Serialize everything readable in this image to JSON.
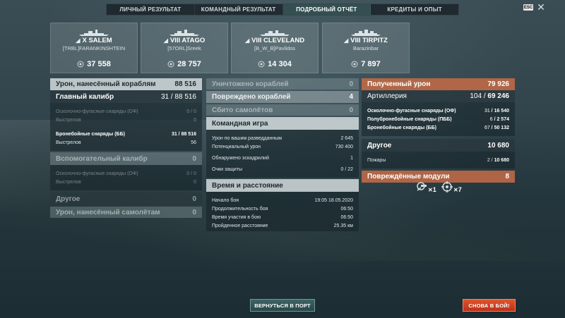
{
  "tabs": [
    {
      "label": "ЛИЧНЫЙ РЕЗУЛЬТАТ",
      "active": false
    },
    {
      "label": "КОМАНДНЫЙ РЕЗУЛЬТАТ",
      "active": false
    },
    {
      "label": "ПОДРОБНЫЙ ОТЧЁТ",
      "active": true
    },
    {
      "label": "КРЕДИТЫ И ОПЫТ",
      "active": false
    }
  ],
  "esc_label": "ESC",
  "close_glyph": "✕",
  "players": [
    {
      "tier": "X",
      "ship": "SALEM",
      "player": "[TRBL]FARANKINSHTEIN",
      "score": "37 558"
    },
    {
      "tier": "VIII",
      "ship": "ATAGO",
      "player": "[57ORL]Sreek",
      "score": "28 757"
    },
    {
      "tier": "VIII",
      "ship": "CLEVELAND",
      "player": "[B_W_B]Pavlidos",
      "score": "14 304"
    },
    {
      "tier": "VIII",
      "ship": "TIRPITZ",
      "player": "Barazinbar",
      "score": "7 897"
    }
  ],
  "damage": {
    "title": "Урон, нанесённый кораблям",
    "total": "88 516",
    "main_battery": {
      "label": "Главный калибр",
      "value": "31 / 88 516"
    },
    "he_label": "Осколочно-фугасные снаряды (ОФ)",
    "he_value": "0 / 0",
    "he_shots_label": "Выстрелов",
    "he_shots": "0",
    "ap_label": "Бронебойные снаряды (ББ)",
    "ap_value_a": "31",
    "ap_value_b": "88 516",
    "ap_shots_label": "Выстрелов",
    "ap_shots": "56",
    "secondary": {
      "label": "Вспомогательный калибр",
      "value": "0"
    },
    "sec_he_label": "Осколочно-фугасные снаряды (ОФ)",
    "sec_he_value": "0 / 0",
    "sec_shots_label": "Выстрелов",
    "sec_shots": "0",
    "other": {
      "label": "Другое",
      "value": "0"
    },
    "planes": {
      "label": "Урон, нанесённый самолётам",
      "value": "0"
    }
  },
  "kills": {
    "destroyed": {
      "label": "Уничтожено кораблей",
      "value": "0"
    },
    "damaged": {
      "label": "Повреждено кораблей",
      "value": "4"
    },
    "planes": {
      "label": "Сбито самолётов",
      "value": "0"
    }
  },
  "team": {
    "title": "Командная игра",
    "spotting": {
      "label": "Урон по вашим разведданным",
      "value": "2 645"
    },
    "potential": {
      "label": "Потенциальный урон",
      "value": "730 400"
    },
    "squadrons": {
      "label": "Обнаружено эскадрилий",
      "value": "1"
    },
    "defense": {
      "label": "Очки защиты",
      "value": "0 / 22"
    }
  },
  "time": {
    "title": "Время и расстояние",
    "start": {
      "label": "Начало боя",
      "value": "19:05  18.05.2020"
    },
    "duration": {
      "label": "Продолжительность боя",
      "value": "06:50"
    },
    "participation": {
      "label": "Время участия в бою",
      "value": "06:50"
    },
    "distance": {
      "label": "Пройденное расстояние",
      "value": "25.35 км"
    }
  },
  "received": {
    "title": "Полученный урон",
    "total": "79 926",
    "artillery": {
      "label": "Артиллерия",
      "value_a": "104",
      "value_b": "69 246"
    },
    "he": {
      "label": "Осколочно-фугасные снаряды (ОФ)",
      "value_a": "31",
      "value_b": "16 540"
    },
    "sap": {
      "label": "Полубронебойные снаряды (ПББ)",
      "value_a": "6",
      "value_b": "2 574"
    },
    "ap": {
      "label": "Бронебойные снаряды (ББ)",
      "value_a": "67",
      "value_b": "50 132"
    },
    "other": {
      "label": "Другое",
      "value": "10 680"
    },
    "fires": {
      "label": "Пожары",
      "value_a": "2",
      "value_b": "10 680"
    }
  },
  "modules": {
    "title": "Повреждённые модули",
    "total": "8",
    "items": [
      {
        "icon": "turret-module-icon",
        "count": "1"
      },
      {
        "icon": "steering-module-icon",
        "count": "7"
      }
    ]
  },
  "buttons": {
    "port": "ВЕРНУТЬСЯ В ПОРТ",
    "battle": "СНОВА В БОЙ!"
  }
}
